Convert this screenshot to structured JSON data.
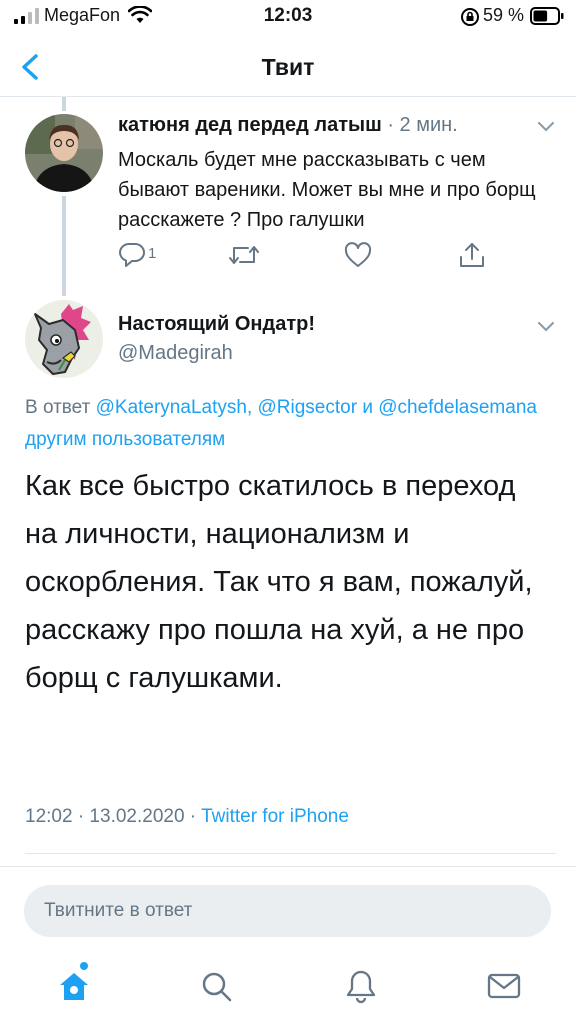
{
  "status_bar": {
    "carrier": "MegaFon",
    "time": "12:03",
    "battery_percent": "59 %",
    "battery_level": 0.59
  },
  "nav": {
    "back_icon": "chevron-left-icon",
    "title": "Твит"
  },
  "reply_tweet": {
    "author_name": "катюня дед пердед латыш",
    "time_ago": "· 2 мин.",
    "text": "Москаль будет мне рассказывать с чем бывают вареники. Может вы мне и про борщ расскажете ? Про галушки",
    "reply_count": "1",
    "icons": [
      "reply-icon",
      "retweet-icon",
      "like-icon",
      "share-icon"
    ]
  },
  "main_tweet": {
    "author_name": "Настоящий Ондатр!",
    "handle": "@Madegirah",
    "reply_prefix": "В ответ",
    "mention_1": "@KaterynaLatysh",
    "separator": ",",
    "mention_2": "@Rigsector",
    "conjunction": "и",
    "mention_3": "@chefdelasemana",
    "others": "другим пользователям",
    "text": "Как все быстро скатилось в переход на личности, национализм и оскорбления. Так что я вам, пожалуй, расскажу про пошла на хуй, а не про борщ с галушками.",
    "timestamp": "12:02 · 13.02.2020 ·",
    "source": "Twitter for iPhone"
  },
  "compose": {
    "placeholder": "Твитните в ответ"
  },
  "tab_bar": {
    "icons": [
      "home-icon",
      "search-icon",
      "notifications-icon",
      "messages-icon"
    ]
  },
  "colors": {
    "accent": "#1da1f2",
    "secondary_text": "#657786",
    "primary_text": "#14171a"
  }
}
